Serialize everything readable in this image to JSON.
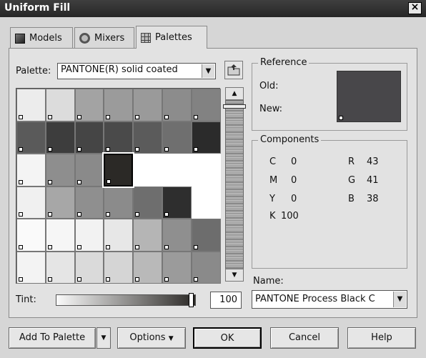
{
  "window": {
    "title": "Uniform Fill",
    "close": "×"
  },
  "tabs": [
    {
      "label": "Models",
      "icon": "models-icon"
    },
    {
      "label": "Mixers",
      "icon": "mixers-icon"
    },
    {
      "label": "Palettes",
      "icon": "palettes-icon",
      "active": true
    }
  ],
  "palette": {
    "label": "Palette:",
    "value": "PANTONE(R) solid coated"
  },
  "reference": {
    "title": "Reference",
    "old_label": "Old:",
    "new_label": "New:",
    "color": "#48474a"
  },
  "components": {
    "title": "Components",
    "cmyk": [
      {
        "k": "C",
        "v": "0"
      },
      {
        "k": "M",
        "v": "0"
      },
      {
        "k": "Y",
        "v": "0"
      },
      {
        "k": "K",
        "v": "100"
      }
    ],
    "rgb": [
      {
        "k": "R",
        "v": "43"
      },
      {
        "k": "G",
        "v": "41"
      },
      {
        "k": "B",
        "v": "38"
      }
    ]
  },
  "name": {
    "label": "Name:",
    "value": "PANTONE Process Black C"
  },
  "tint": {
    "label": "Tint:",
    "value": "100"
  },
  "swatches": [
    [
      "#ececec",
      "#dcdcdc",
      "#a3a3a3",
      "#9b9b9b",
      "#9a9a9a",
      "#8c8c8c",
      "#828282"
    ],
    [
      "#5a5a5a",
      "#3d3d3d",
      "#454545",
      "#4a4a4a",
      "#5b5b5b",
      "#6f6f6f",
      "#2b2b2b"
    ],
    [
      "#f4f4f4",
      "#8e8e8e",
      "#8a8a8a",
      "#2b2926",
      "#ffffff",
      "#ffffff",
      "#ffffff"
    ],
    [
      "#f0f0f0",
      "#a7a7a7",
      "#8f8f8f",
      "#8b8b8b",
      "#6e6e6e",
      "#2e2e2e",
      "#ffffff"
    ],
    [
      "#fafafa",
      "#f6f6f6",
      "#f2f2f2",
      "#e7e7e7",
      "#b5b5b5",
      "#8f8f8f",
      "#6d6d6d"
    ],
    [
      "#f3f3f3",
      "#e5e5e5",
      "#dadada",
      "#d5d5d5",
      "#b9b9b9",
      "#9b9b9b",
      "#8a8a8a"
    ]
  ],
  "selected_swatch": [
    2,
    3
  ],
  "buttons": {
    "add_to_palette": "Add To Palette",
    "options": "Options",
    "ok": "OK",
    "cancel": "Cancel",
    "help": "Help"
  }
}
